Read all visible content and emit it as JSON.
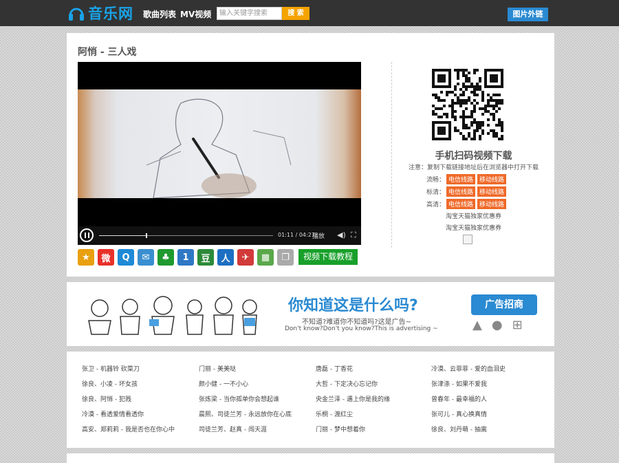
{
  "topbar": {
    "logo_text": "音乐网",
    "nav": [
      "歌曲列表",
      "MV视频"
    ],
    "search_placeholder": "输入关键字搜索",
    "search_button": "搜 索",
    "image_link": "图片外链"
  },
  "video": {
    "title": "阿悄 - 三人戏",
    "time": "01:11 / 04:27",
    "quality": "播放",
    "progress": 0.27
  },
  "share": {
    "icons": [
      "favorite-star-icon",
      "weibo-icon",
      "qzone-icon",
      "email-icon",
      "clover-icon",
      "renren-icon",
      "douban-icon",
      "people-icon",
      "bird-icon",
      "map-icon",
      "copy-icon"
    ],
    "tutorial_label": "视频下载教程"
  },
  "download": {
    "title": "手机扫码视频下载",
    "note": "注意：复制下载链接地址后在浏览器中打开下载",
    "rows": [
      {
        "label": "流畅：",
        "tags": [
          "电信线路",
          "移动线路"
        ]
      },
      {
        "label": "标清：",
        "tags": [
          "电信线路",
          "移动线路"
        ]
      },
      {
        "label": "高清：",
        "tags": [
          "电信线路",
          "移动线路"
        ]
      }
    ],
    "promos": [
      "淘宝天猫独家优惠券",
      "淘宝天猫独家优惠券"
    ]
  },
  "ad": {
    "headline": "你知道这是什么吗?",
    "sub_cn": "不知道?难道你不知道吗?这是广告~",
    "sub_en": "Don't know?Don't you know?This is advertising ~",
    "button": "广告招商"
  },
  "songs": [
    [
      "张卫 - 机器铃 砍菜刀",
      "徐良、小凌 - 坏女孩",
      "徐良、阿悄 - 犯贱",
      "冷漠 - 看透爱情看透你",
      "高安、郑莉莉 - 我是否也在你心中"
    ],
    [
      "门丽 - 美美哒",
      "颜小健 - 一不小心",
      "张炼梁 - 当你孤单你会想起谁",
      "晨熙、司徒兰芳 - 永远放你在心底",
      "司徒兰芳、赵真 - 闯天涯"
    ],
    [
      "唐磊 - 丁香花",
      "大哲 - 下定决心忘记你",
      "央金兰泽 - 遇上你是我的缘",
      "乐桐 - 渡红尘",
      "门丽 - 梦中想着你"
    ],
    [
      "冷漠、云菲菲 - 爱的血泪史",
      "张津涤 - 如果不爱我",
      "曾春年 - 最幸福的人",
      "张可儿 - 真心换真情",
      "徐良、刘丹萌 - 抽离"
    ]
  ]
}
